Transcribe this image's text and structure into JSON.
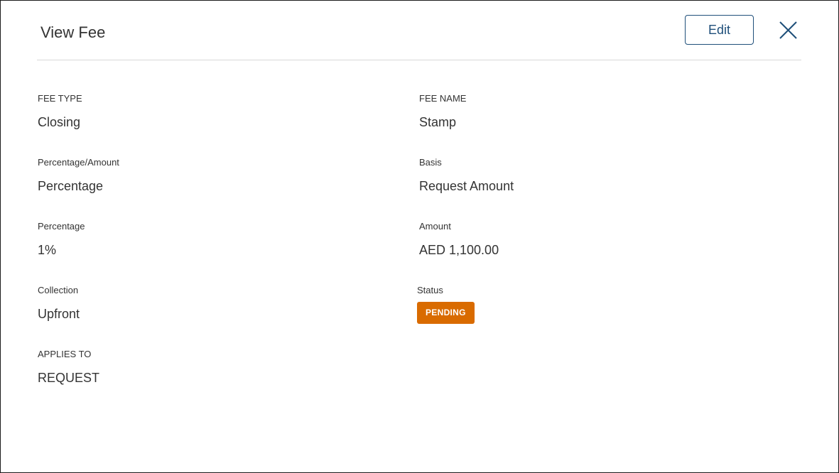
{
  "header": {
    "title": "View Fee",
    "edit_label": "Edit",
    "close_icon": "close-icon"
  },
  "fields": {
    "fee_type": {
      "label": "FEE TYPE",
      "value": "Closing"
    },
    "fee_name": {
      "label": "FEE NAME",
      "value": "Stamp"
    },
    "percentage_amount": {
      "label": "Percentage/Amount",
      "value": "Percentage"
    },
    "basis": {
      "label": "Basis",
      "value": "Request Amount"
    },
    "percentage": {
      "label": "Percentage",
      "value": "1%"
    },
    "amount": {
      "label": "Amount",
      "value": "AED 1,100.00"
    },
    "collection": {
      "label": "Collection",
      "value": "Upfront"
    },
    "status": {
      "label": "Status",
      "value": "PENDING",
      "color": "#d96b00"
    },
    "applies_to": {
      "label": "APPLIES TO",
      "value": "REQUEST"
    }
  },
  "colors": {
    "accent": "#1f4f7a",
    "status_pending": "#d96b00",
    "text": "#333333",
    "divider": "#d8d8d8"
  }
}
